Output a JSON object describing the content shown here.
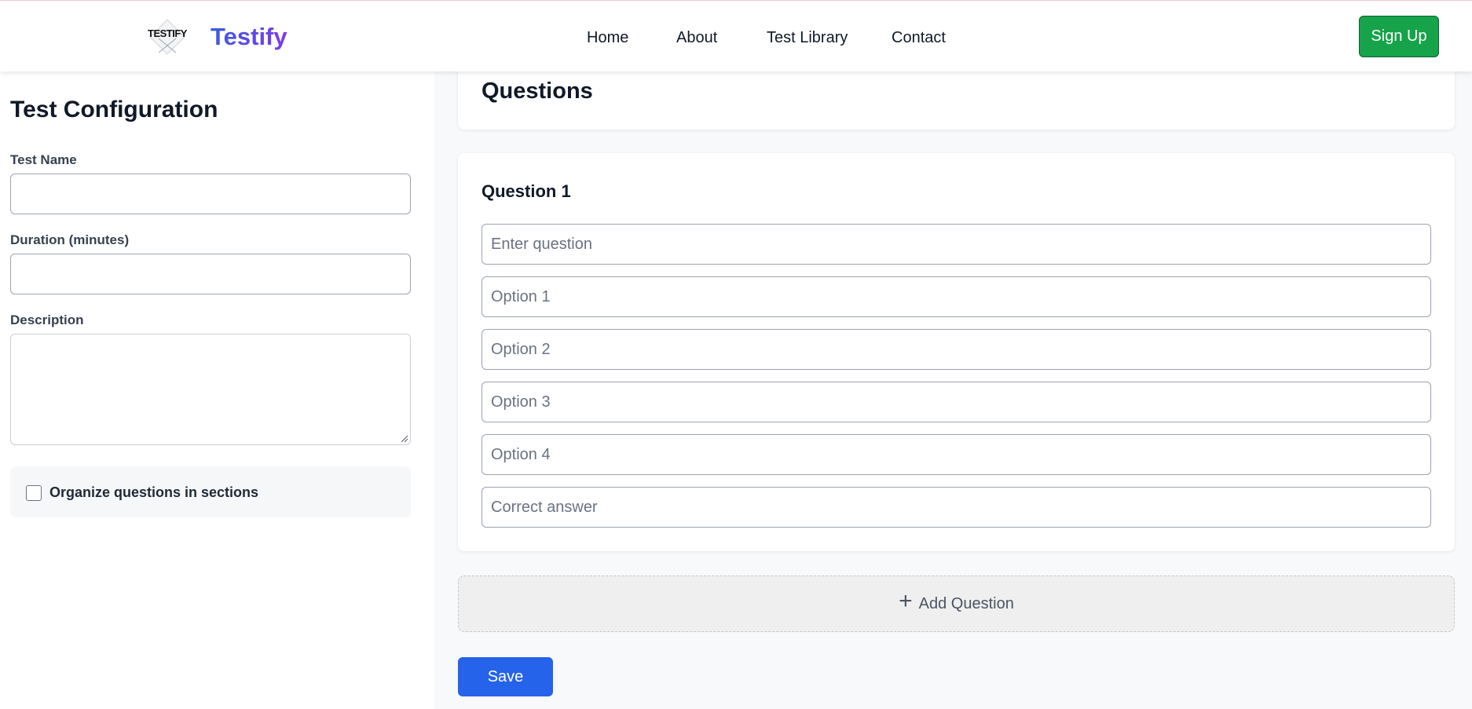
{
  "navbar": {
    "logo_text": "TESTIFY",
    "brand": "Testify",
    "links": [
      "Home",
      "About",
      "Test Library",
      "Contact"
    ],
    "signup_label": "Sign Up"
  },
  "config": {
    "title": "Test Configuration",
    "test_name_label": "Test Name",
    "test_name_value": "",
    "duration_label": "Duration (minutes)",
    "duration_value": "",
    "description_label": "Description",
    "description_value": "",
    "sections_checkbox_label": "Organize questions in sections",
    "sections_checked": false
  },
  "questions": {
    "title": "Questions",
    "items": [
      {
        "title": "Question 1",
        "question_placeholder": "Enter question",
        "option_placeholders": [
          "Option 1",
          "Option 2",
          "Option 3",
          "Option 4"
        ],
        "correct_placeholder": "Correct answer"
      }
    ],
    "add_label": "Add Question",
    "add_icon": "plus-icon"
  },
  "save_label": "Save",
  "colors": {
    "signup": "#16a34a",
    "save": "#2563eb",
    "brand_gradient_start": "#3b5bdb",
    "brand_gradient_end": "#7c3aed"
  }
}
